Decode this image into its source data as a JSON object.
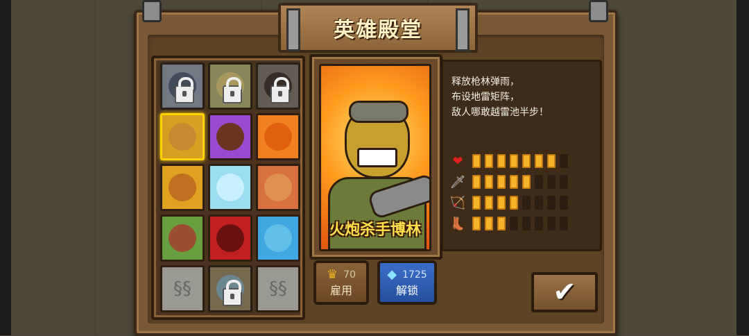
{
  "title": "英雄殿堂",
  "grid": {
    "cells": [
      {
        "name": "hero-slot-1",
        "color": "#6c7a8c",
        "face": "#3c4c64",
        "locked": true
      },
      {
        "name": "hero-slot-2",
        "color": "#8a8a3a",
        "face": "#b89830",
        "locked": true
      },
      {
        "name": "hero-slot-3",
        "color": "#6a5a4a",
        "face": "#3c2c24",
        "locked": true
      },
      {
        "name": "hero-slot-4",
        "color": "#d8a020",
        "face": "#c88a30",
        "locked": false,
        "selected": true
      },
      {
        "name": "hero-slot-5",
        "color": "#9a4ad0",
        "face": "#6a3420",
        "locked": false
      },
      {
        "name": "hero-slot-6",
        "color": "#f08020",
        "face": "#e06010",
        "locked": false
      },
      {
        "name": "hero-slot-7",
        "color": "#e0a020",
        "face": "#c07020",
        "locked": false
      },
      {
        "name": "hero-slot-8",
        "color": "#9adcf0",
        "face": "#c8f0ff",
        "locked": false
      },
      {
        "name": "hero-slot-9",
        "color": "#d87040",
        "face": "#e09050",
        "locked": false
      },
      {
        "name": "hero-slot-10",
        "color": "#68a040",
        "face": "#9a5030",
        "locked": false
      },
      {
        "name": "hero-slot-11",
        "color": "#c02020",
        "face": "#6a1010",
        "locked": false
      },
      {
        "name": "hero-slot-12",
        "color": "#40a8e0",
        "face": "#60c0e8",
        "locked": false
      },
      {
        "name": "empty-slot-1",
        "empty": true
      },
      {
        "name": "hero-slot-13",
        "color": "#7a6a3a",
        "face": "#5a8aa0",
        "locked": true
      },
      {
        "name": "empty-slot-2",
        "empty": true
      }
    ]
  },
  "hero": {
    "name": "火炮杀手博林"
  },
  "description": {
    "lines": [
      "释放枪林弹雨，",
      "布设地雷矩阵，",
      "敌人哪敢越雷池半步！"
    ]
  },
  "stats": [
    {
      "icon": "heart-icon",
      "glyph": "❤",
      "color": "#e02020",
      "value": 7,
      "max": 8
    },
    {
      "icon": "sword-icon",
      "glyph": "🗡",
      "color": "#d0d0d0",
      "value": 5,
      "max": 8
    },
    {
      "icon": "bow-icon",
      "glyph": "🏹",
      "color": "#8a6a3a",
      "value": 4,
      "max": 8
    },
    {
      "icon": "boot-icon",
      "glyph": "👢",
      "color": "#a08060",
      "value": 3,
      "max": 8
    }
  ],
  "buttons": {
    "hire_cost": "70",
    "hire_label": "雇用",
    "unlock_cost": "1725",
    "unlock_label": "解锁"
  },
  "colors": {
    "accent_gold": "#f6b42a",
    "unlock_blue": "#3b6ec8"
  }
}
